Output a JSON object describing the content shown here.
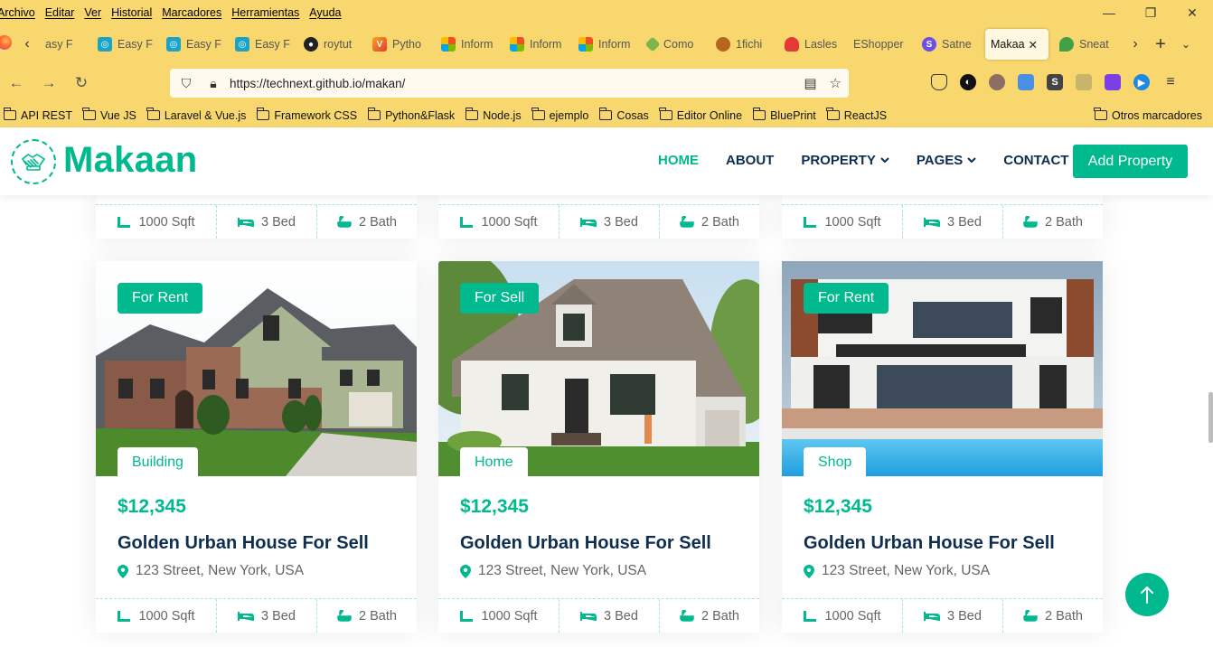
{
  "browser": {
    "menu": [
      "Archivo",
      "Editar",
      "Ver",
      "Historial",
      "Marcadores",
      "Herramientas",
      "Ayuda"
    ],
    "tabs": [
      {
        "label": "asy F",
        "favicon_color": "#ffffff"
      },
      {
        "label": "Easy F",
        "favicon_color": "#1aa3c7"
      },
      {
        "label": "Easy F",
        "favicon_color": "#1aa3c7"
      },
      {
        "label": "Easy F",
        "favicon_color": "#1aa3c7"
      },
      {
        "label": "roytut",
        "favicon_color": "#222222"
      },
      {
        "label": "Pytho",
        "favicon_color": "#f7a51c"
      },
      {
        "label": "Inform",
        "favicon_color": "#e94e1b"
      },
      {
        "label": "Inform",
        "favicon_color": "#e94e1b"
      },
      {
        "label": "Inform",
        "favicon_color": "#e94e1b"
      },
      {
        "label": "Como",
        "favicon_color": "#7ab648"
      },
      {
        "label": "1fichi",
        "favicon_color": "#b5651d"
      },
      {
        "label": "Lasles",
        "favicon_color": "#e53935"
      },
      {
        "label": "EShopper",
        "favicon_color": "#f8d86e"
      },
      {
        "label": "Satne",
        "favicon_color": "#6c4ee8"
      },
      {
        "label": "Makaa",
        "favicon_color": "#ffffff"
      },
      {
        "label": "Sneat",
        "favicon_color": "#43a047"
      }
    ],
    "url": "https://technext.github.io/makan/",
    "bookmarks": [
      "API REST",
      "Vue JS",
      "Laravel & Vue.js",
      "Framework CSS",
      "Python&Flask",
      "Node.js",
      "ejemplo",
      "Cosas",
      "Editor Online",
      "BluePrint",
      "ReactJS"
    ],
    "other_bookmarks": "Otros marcadores"
  },
  "site": {
    "brand": "Makaan",
    "nav": [
      {
        "label": "HOME",
        "active": true,
        "dropdown": false
      },
      {
        "label": "ABOUT",
        "active": false,
        "dropdown": false
      },
      {
        "label": "PROPERTY",
        "active": false,
        "dropdown": true
      },
      {
        "label": "PAGES",
        "active": false,
        "dropdown": true
      },
      {
        "label": "CONTACT",
        "active": false,
        "dropdown": false
      }
    ],
    "cta": "Add Property",
    "accent_color": "#00b98e",
    "dark_color": "#0e2e50"
  },
  "top_row_features": {
    "sqft": "1000 Sqft",
    "bed": "3 Bed",
    "bath": "2 Bath"
  },
  "listings": [
    {
      "status": "For Rent",
      "type": "Building",
      "price": "$12,345",
      "title": "Golden Urban House For Sell",
      "address": "123 Street, New York, USA",
      "sqft": "1000 Sqft",
      "bed": "3 Bed",
      "bath": "2 Bath"
    },
    {
      "status": "For Sell",
      "type": "Home",
      "price": "$12,345",
      "title": "Golden Urban House For Sell",
      "address": "123 Street, New York, USA",
      "sqft": "1000 Sqft",
      "bed": "3 Bed",
      "bath": "2 Bath"
    },
    {
      "status": "For Rent",
      "type": "Shop",
      "price": "$12,345",
      "title": "Golden Urban House For Sell",
      "address": "123 Street, New York, USA",
      "sqft": "1000 Sqft",
      "bed": "3 Bed",
      "bath": "2 Bath"
    }
  ]
}
